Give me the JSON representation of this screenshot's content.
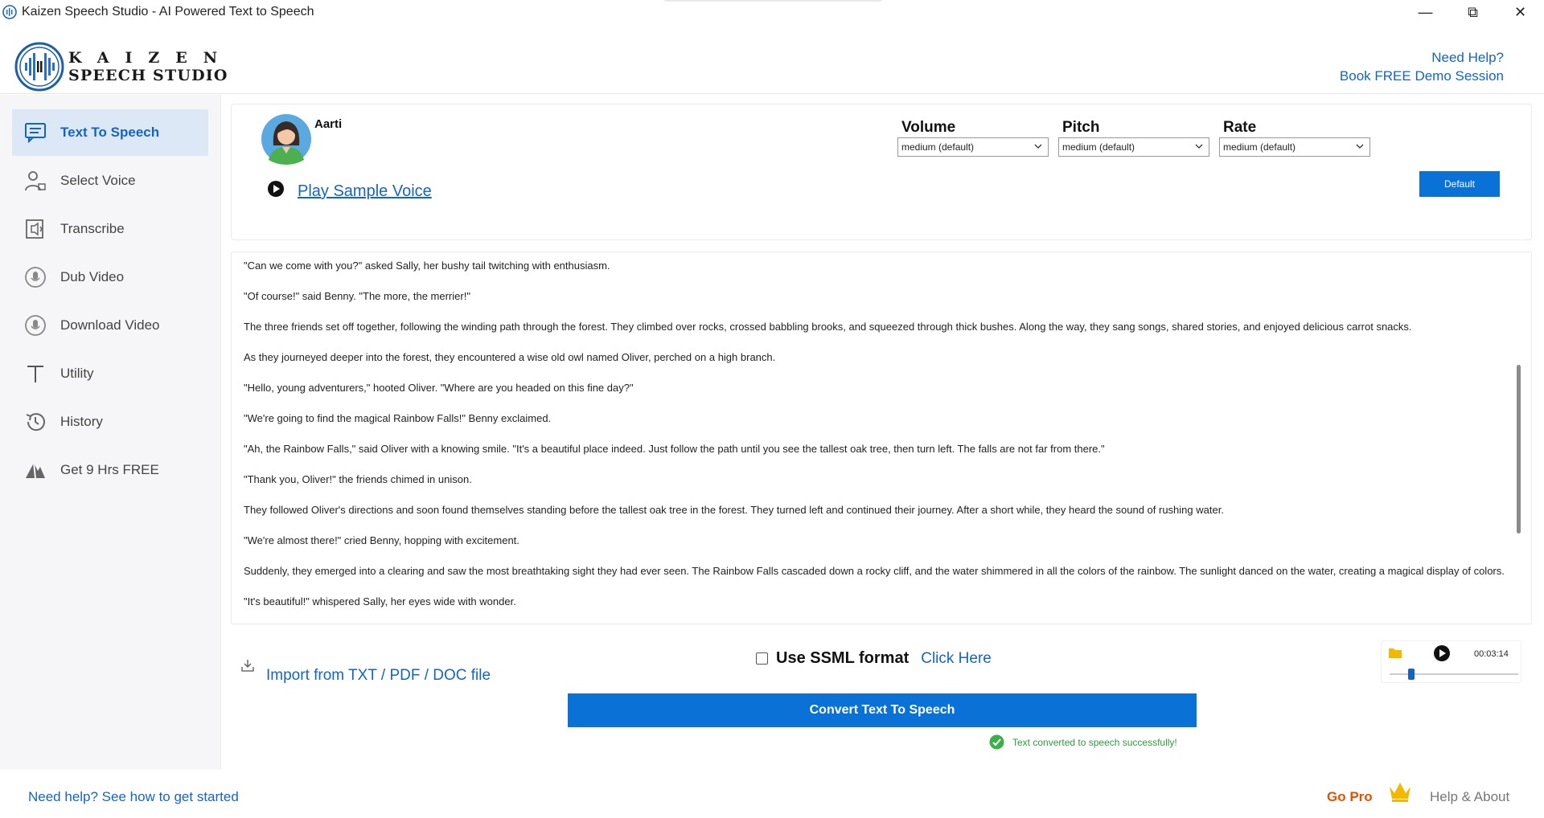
{
  "window": {
    "title": "Kaizen Speech Studio - AI Powered Text to Speech",
    "minimize": "—",
    "restore": "⧉",
    "close": "✕"
  },
  "logo": {
    "line1": "KAIZEN",
    "line2": "SPEECH STUDIO"
  },
  "header": {
    "need_help": "Need Help?",
    "book_demo": "Book FREE Demo Session"
  },
  "sidebar": {
    "items": [
      {
        "label": "Text To Speech",
        "icon": "chat-icon",
        "active": true
      },
      {
        "label": "Select Voice",
        "icon": "user-voice-icon"
      },
      {
        "label": "Transcribe",
        "icon": "transcribe-icon"
      },
      {
        "label": "Dub Video",
        "icon": "microphone-icon"
      },
      {
        "label": "Download Video",
        "icon": "microphone-icon"
      },
      {
        "label": "Utility",
        "icon": "text-t-icon"
      },
      {
        "label": "History",
        "icon": "history-icon"
      },
      {
        "label": "Get 9 Hrs FREE",
        "icon": "mountain-icon"
      }
    ]
  },
  "voice": {
    "name": "Aarti",
    "play_sample": "Play Sample Voice"
  },
  "controls": {
    "volume": {
      "label": "Volume",
      "value": "medium (default)"
    },
    "pitch": {
      "label": "Pitch",
      "value": "medium (default)"
    },
    "rate": {
      "label": "Rate",
      "value": "medium (default)"
    },
    "default_button": "Default"
  },
  "text": {
    "paragraphs": [
      "\"Can we come with you?\" asked Sally, her bushy tail twitching with enthusiasm.",
      "\"Of course!\" said Benny. \"The more, the merrier!\"",
      "The three friends set off together, following the winding path through the forest. They climbed over rocks, crossed babbling brooks, and squeezed through thick bushes. Along the way, they sang songs, shared stories, and enjoyed delicious carrot snacks.",
      "As they journeyed deeper into the forest, they encountered a wise old owl named Oliver, perched on a high branch.",
      "\"Hello, young adventurers,\" hooted Oliver. \"Where are you headed on this fine day?\"",
      "\"We're going to find the magical Rainbow Falls!\" Benny exclaimed.",
      "\"Ah, the Rainbow Falls,\" said Oliver with a knowing smile. \"It's a beautiful place indeed. Just follow the path until you see the tallest oak tree, then turn left. The falls are not far from there.\"",
      "\"Thank you, Oliver!\" the friends chimed in unison.",
      "They followed Oliver's directions and soon found themselves standing before the tallest oak tree in the forest. They turned left and continued their journey. After a short while, they heard the sound of rushing water.",
      "\"We're almost there!\" cried Benny, hopping with excitement.",
      "Suddenly, they emerged into a clearing and saw the most breathtaking sight they had ever seen. The Rainbow Falls cascaded down a rocky cliff, and the water shimmered in all the colors of the rainbow. The sunlight danced on the water, creating a magical display of colors.",
      "\"It's beautiful!\" whispered Sally, her eyes wide with wonder."
    ]
  },
  "import": {
    "label": "Import from TXT / PDF / DOC file"
  },
  "ssml": {
    "label": "Use SSML format",
    "link": "Click Here",
    "checked": false
  },
  "player": {
    "time": "00:03:14",
    "progress": 0.17
  },
  "convert": {
    "label": "Convert Text To Speech"
  },
  "status": {
    "message": "Text converted to speech successfully!"
  },
  "footer": {
    "help": "Need help? See how to get started",
    "go_pro": "Go Pro",
    "help_about": "Help & About"
  },
  "colors": {
    "accent": "#0a72d6",
    "link": "#1565c0",
    "success": "#2e9e3a",
    "go_pro": "#e65100",
    "sidebar_active": "#dde8f6"
  }
}
